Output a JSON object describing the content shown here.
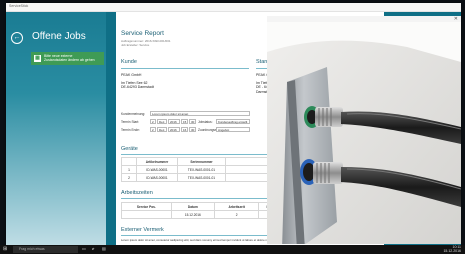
{
  "window": {
    "title": "ServiceStick"
  },
  "sidebar": {
    "title": "Offene Jobs",
    "job": {
      "line1": "Bitte neue externe",
      "line2": "Zustandsdaten ändern ab gehen"
    }
  },
  "report": {
    "title": "Service Report",
    "meta1": "Auftragsnummer: 2016-SSR-001/001",
    "meta2": "Job Ersteller: Service",
    "kunde_label": "Kunde",
    "standort_label": "Standort",
    "kunde_addr": [
      "PEAK GmbH",
      "Im Tiefen See 62",
      "DE-64293 Darmstadt"
    ],
    "standort_addr": [
      "PEAK GmbH",
      "Im Tiefen S",
      "DE - 6429",
      "Darmstadt"
    ],
    "fields": {
      "kundenmeinung_label": "Kundenmeinung:",
      "kundenmeinung_value": "Lorem ipsum dolor sit amet",
      "termin_start_label": "Termin Start:",
      "termin_ende_label": "Termin Ende:",
      "start_day": "2",
      "start_month": "Dez.",
      "start_year": "2016",
      "start_hour": "15",
      "start_min": "30",
      "ende_day": "2",
      "ende_month": "Dez.",
      "ende_year": "2016",
      "ende_hour": "16",
      "ende_min": "30",
      "jobstatus_label": "Jobstatus:",
      "jobstatus_value": "Kundenauftrag erstellt",
      "zuordnung_label": "Zuordnungsstatus:",
      "zuordnung_value": "Angebot"
    },
    "geraete": {
      "label": "Geräte",
      "headers": [
        "Artikelnummer",
        "Seriennummer"
      ],
      "rows": [
        {
          "n": "1",
          "artikel": "ID-WAS-00001",
          "serie": "TEX-WAS-0001-01"
        },
        {
          "n": "2",
          "artikel": "ID-WAS-00001",
          "serie": "TEX-WAS-0001-01"
        }
      ]
    },
    "arbeitszeiten": {
      "label": "Arbeitszeiten",
      "headers": [
        "Service Pos.",
        "Datum",
        "Arbeitszeit",
        "KM",
        "Arbeitszeit"
      ],
      "row": {
        "pos": "",
        "datum": "15.12.2016",
        "arbeitszeit": "2",
        "km": "35",
        "arbeitszeit2": "8"
      }
    },
    "externer_vermerk": {
      "label": "Externer Vermerk",
      "text": "Lorem ipsum dolor sit amet, consetetur sadipscing elitr, sed diam nonumy eirmod tempor invidunt ut labore et dolore magna aliquyam erat, sed diam voluptua."
    }
  },
  "taskbar": {
    "search_placeholder": "Frag mich etwas",
    "time": "10:11",
    "date": "15.12.2016"
  }
}
